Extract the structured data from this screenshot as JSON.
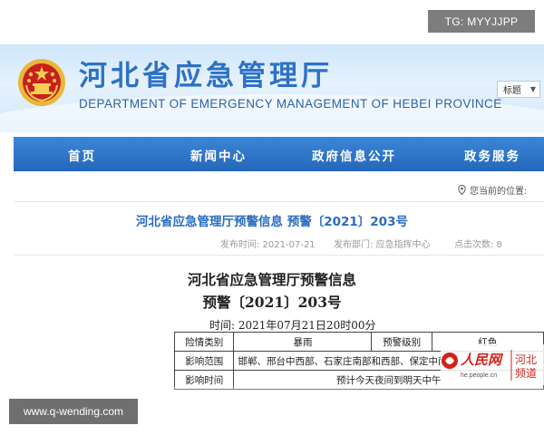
{
  "watermarks": {
    "top": "TG: MYYJJPP",
    "bottom": "www.q-wending.com"
  },
  "header": {
    "title": "河北省应急管理厅",
    "subtitle_en": "DEPARTMENT OF EMERGENCY MANAGEMENT OF HEBEI PROVINCE",
    "search_select": "标题"
  },
  "nav": {
    "items": [
      "首页",
      "新闻中心",
      "政府信息公开",
      "政务服务"
    ]
  },
  "breadcrumb": {
    "label": "您当前的位置:"
  },
  "article": {
    "title": "河北省应急管理厅预警信息 预警〔2021〕203号",
    "meta": {
      "published": "发布时间: 2021-07-21",
      "department": "发布部门: 应急指挥中心",
      "clicks": "点击次数: 8"
    }
  },
  "document": {
    "title_line1": "河北省应急管理厅预警信息",
    "title_line2": "预警〔2021〕203号",
    "time": "时间: 2021年07月21日20时00分",
    "table": {
      "rows": [
        [
          "险情类别",
          "暴雨",
          "预警级别",
          "红色"
        ],
        [
          "影响范围",
          "邯郸、邢台中西部、石家庄南部和西部、保定中南部"
        ],
        [
          "影响时间",
          "预计今天夜间到明天中午"
        ]
      ]
    }
  },
  "overlay_logo": {
    "brand": "人民网",
    "domain": "he.people.cn",
    "region_line1": "河北",
    "region_line2": "频道"
  },
  "colors": {
    "nav": "#2467b9",
    "title_blue": "#2c71c6",
    "link_blue": "#2a6cc0",
    "emblem_red": "#c8201c",
    "emblem_gold": "#e8b83a"
  }
}
